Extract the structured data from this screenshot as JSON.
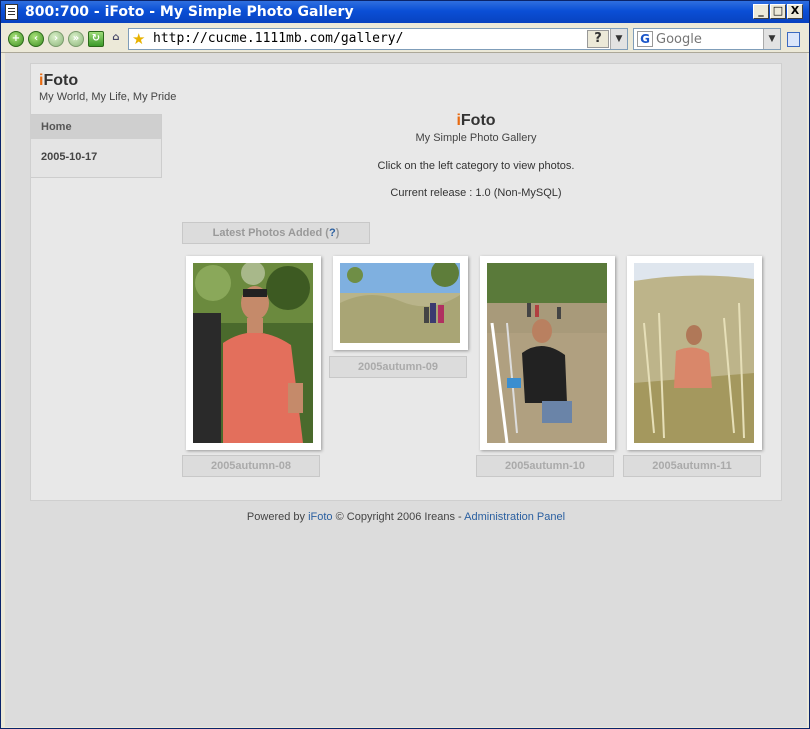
{
  "window": {
    "title": "800:700 - iFoto - My Simple Photo Gallery",
    "controls": {
      "minimize": "_",
      "maximize": "□",
      "close": "X"
    }
  },
  "browser": {
    "address": "http://cucme.1111mb.com/gallery/",
    "help_btn": "?",
    "search_placeholder": "Google",
    "search_logo": "G",
    "dropdown": "▼",
    "star": "★",
    "nav_icons": [
      "back-icon",
      "forward-icon",
      "go-icon",
      "refresh-icon",
      "home-icon"
    ]
  },
  "site": {
    "brand_first": "i",
    "brand_rest": "Foto",
    "tagline": "My World, My Life, My Pride"
  },
  "sidebar": {
    "items": [
      {
        "label": "Home"
      },
      {
        "label": "2005-10-17"
      }
    ]
  },
  "main": {
    "title_first": "i",
    "title_rest": "Foto",
    "subtitle": "My Simple Photo Gallery",
    "instruction": "Click on the left category to view photos.",
    "release": "Current release : 1.0 (Non-MySQL)",
    "latest_label": "Latest Photos Added (",
    "latest_help": "?",
    "latest_close": ")"
  },
  "photos": [
    {
      "caption": "2005autumn-08"
    },
    {
      "caption": "2005autumn-09"
    },
    {
      "caption": "2005autumn-10"
    },
    {
      "caption": "2005autumn-11"
    }
  ],
  "footer": {
    "powered": "Powered by ",
    "brand": "iFoto",
    "copyright": " © Copyright 2006 Ireans - ",
    "admin": "Administration Panel"
  },
  "colors": {
    "accent": "#e86a10",
    "link": "#2a5fa0",
    "titlebar": "#0a4fd6"
  }
}
